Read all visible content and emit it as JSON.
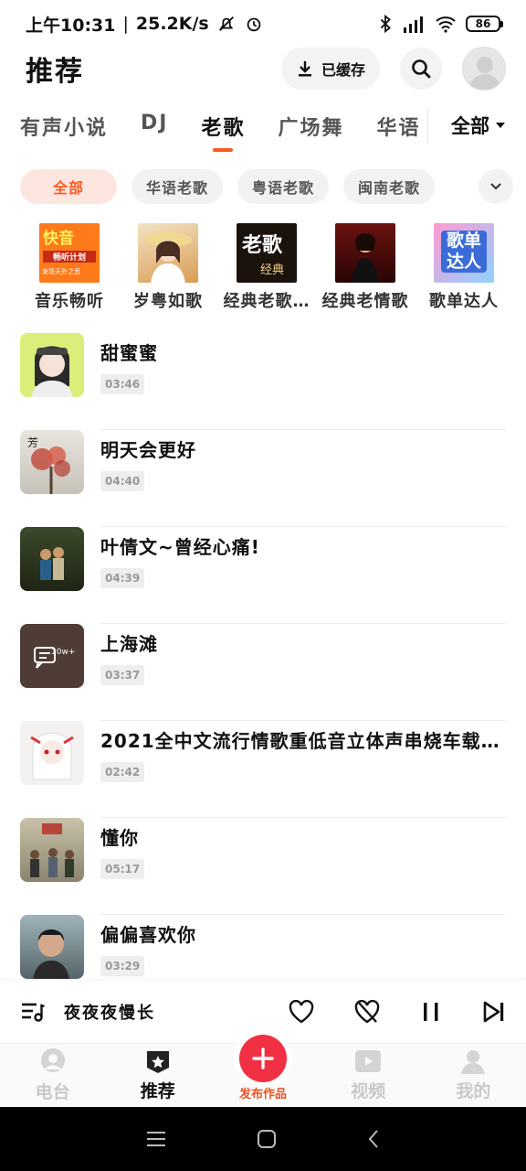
{
  "status": {
    "time": "上午10:31",
    "net_speed": "25.2K/s",
    "battery": "86"
  },
  "header": {
    "title": "推荐",
    "cache_label": "已缓存"
  },
  "tabs": [
    "有声小说",
    "DJ",
    "老歌",
    "广场舞",
    "华语"
  ],
  "active_tab": "老歌",
  "all_tab": "全部",
  "chips": [
    "全部",
    "华语老歌",
    "粤语老歌",
    "闽南老歌"
  ],
  "playlists": [
    {
      "name": "音乐畅听",
      "cover_title": "快音",
      "cover_sub": "畅听计划",
      "cover_foot": "发现天外之音"
    },
    {
      "name": "岁粤如歌"
    },
    {
      "name": "经典老歌…",
      "cover_title": "老歌",
      "cover_sub": "经典"
    },
    {
      "name": "经典老情歌"
    },
    {
      "name": "歌单达人",
      "cover_title": "歌单达人"
    }
  ],
  "songs": [
    {
      "title": "甜蜜蜜",
      "duration": "03:46"
    },
    {
      "title": "明天会更好",
      "duration": "04:40"
    },
    {
      "title": "叶倩文~曾经心痛!",
      "duration": "04:39"
    },
    {
      "title": "上海滩",
      "duration": "03:37",
      "badge": "10w+"
    },
    {
      "title": "2021全中文流行情歌重低音立体声串烧车载…",
      "duration": "02:42"
    },
    {
      "title": "懂你",
      "duration": "05:17"
    },
    {
      "title": "偏偏喜欢你",
      "duration": "03:29"
    }
  ],
  "player": {
    "now_playing": "夜夜夜慢长"
  },
  "bottom_nav": {
    "radio": "电台",
    "recommend": "推荐",
    "publish": "发布作品",
    "video": "视频",
    "mine": "我的"
  },
  "colors": {
    "accent": "#ff5a1f",
    "publish": "#f23043",
    "chip_active_bg": "#fde6df"
  }
}
